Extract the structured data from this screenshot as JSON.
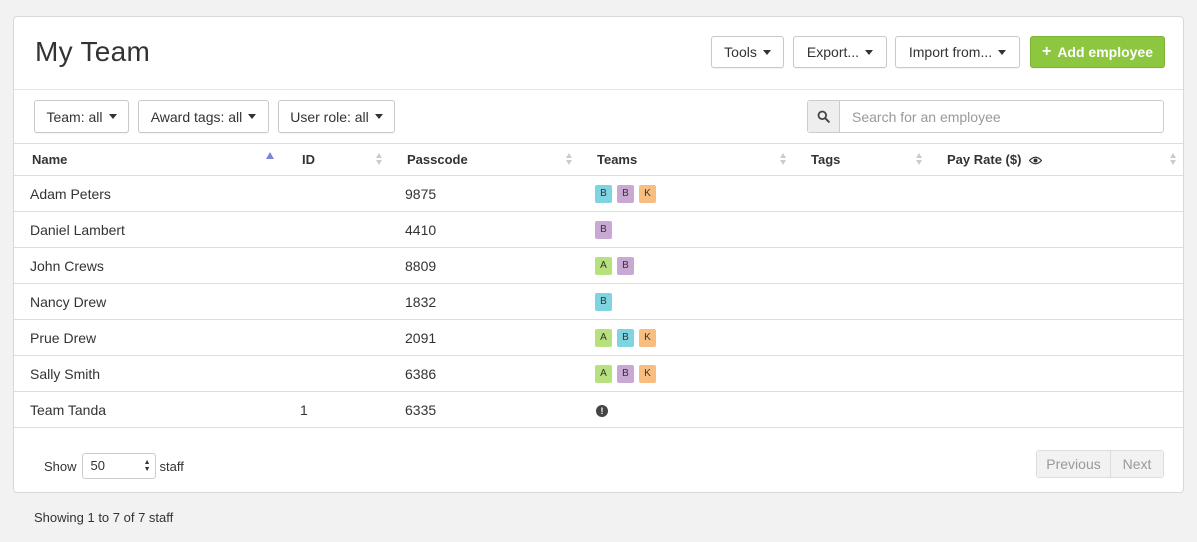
{
  "page_title": "My Team",
  "toolbar": {
    "tools_label": "Tools",
    "export_label": "Export...",
    "import_label": "Import from...",
    "add_label": "Add employee"
  },
  "filters": {
    "team_label": "Team: all",
    "award_tags_label": "Award tags: all",
    "user_role_label": "User role: all"
  },
  "search": {
    "placeholder": "Search for an employee",
    "value": ""
  },
  "table": {
    "columns": [
      "Name",
      "ID",
      "Passcode",
      "Teams",
      "Tags",
      "Pay Rate ($)"
    ],
    "sort_column": "Name",
    "rows": [
      {
        "name": "Adam Peters",
        "id": "",
        "passcode": "9875",
        "teams": [
          "B",
          "B",
          "K"
        ],
        "tags": "",
        "pay_rate": ""
      },
      {
        "name": "Daniel Lambert",
        "id": "",
        "passcode": "4410",
        "teams": [
          "B"
        ],
        "tags": "",
        "pay_rate": ""
      },
      {
        "name": "John Crews",
        "id": "",
        "passcode": "8809",
        "teams": [
          "A",
          "B"
        ],
        "tags": "",
        "pay_rate": ""
      },
      {
        "name": "Nancy Drew",
        "id": "",
        "passcode": "1832",
        "teams": [
          "B"
        ],
        "tags": "",
        "pay_rate": ""
      },
      {
        "name": "Prue Drew",
        "id": "",
        "passcode": "2091",
        "teams": [
          "A",
          "B",
          "K"
        ],
        "tags": "",
        "pay_rate": ""
      },
      {
        "name": "Sally Smith",
        "id": "",
        "passcode": "6386",
        "teams": [
          "A",
          "B",
          "K"
        ],
        "tags": "",
        "pay_rate": ""
      },
      {
        "name": "Team Tanda",
        "id": "1",
        "passcode": "6335",
        "teams": [],
        "tags": "",
        "pay_rate": "",
        "alert": true
      }
    ]
  },
  "badge_colors": {
    "row0": [
      "#7fd4e0",
      "#c9a8d4",
      "#f9bd80"
    ],
    "row1": [
      "#c9a8d4"
    ],
    "row2": [
      "#b7e07f",
      "#c9a8d4"
    ],
    "row3": [
      "#7fd4e0"
    ],
    "row4": [
      "#b7e07f",
      "#7fd4e0",
      "#f9bd80"
    ],
    "row5": [
      "#b7e07f",
      "#c9a8d4",
      "#f9bd80"
    ]
  },
  "footer": {
    "show_label": "Show",
    "page_size": "50",
    "staff_label": "staff",
    "previous_label": "Previous",
    "next_label": "Next",
    "summary": "Showing 1 to 7 of 7 staff"
  },
  "colors": {
    "accent_green": "#8dc63f",
    "sort_active": "#7b88d9"
  },
  "icons": {
    "search": "search-icon",
    "eye": "eye-icon",
    "alert": "alert-icon",
    "plus": "plus-icon"
  }
}
